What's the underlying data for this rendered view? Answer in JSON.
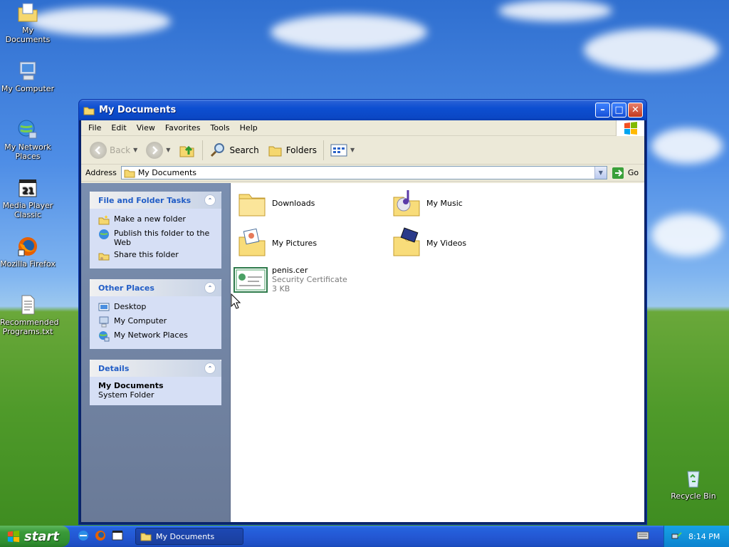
{
  "desktop": {
    "icons": [
      {
        "label": "My Documents"
      },
      {
        "label": "My Computer"
      },
      {
        "label": "My Network Places"
      },
      {
        "label": "Media Player Classic"
      },
      {
        "label": "Mozilla Firefox"
      },
      {
        "label": "Recommended Programs.txt"
      },
      {
        "label": "Recycle Bin"
      }
    ]
  },
  "window": {
    "title": "My Documents",
    "menu": [
      "File",
      "Edit",
      "View",
      "Favorites",
      "Tools",
      "Help"
    ],
    "toolbar": {
      "back": "Back",
      "search": "Search",
      "folders": "Folders"
    },
    "address": {
      "label": "Address",
      "value": "My Documents",
      "go": "Go"
    },
    "tasks": {
      "file_folder": {
        "title": "File and Folder Tasks",
        "items": [
          "Make a new folder",
          "Publish this folder to the Web",
          "Share this folder"
        ]
      },
      "other_places": {
        "title": "Other Places",
        "items": [
          "Desktop",
          "My Computer",
          "My Network Places"
        ]
      },
      "details": {
        "title": "Details",
        "name": "My Documents",
        "type": "System Folder"
      }
    },
    "files": [
      {
        "name": "Downloads"
      },
      {
        "name": "My Music"
      },
      {
        "name": "My Pictures"
      },
      {
        "name": "My Videos"
      },
      {
        "name": "penis.cer",
        "type": "Security Certificate",
        "size": "3 KB"
      }
    ]
  },
  "taskbar": {
    "start": "start",
    "task_button": "My Documents",
    "clock": "8:14 PM"
  },
  "colors": {
    "titlebar": "#0b47c4",
    "taskbar": "#2458d4",
    "start": "#3a9a39",
    "tray": "#0c83cf",
    "link": "#215dc6"
  }
}
